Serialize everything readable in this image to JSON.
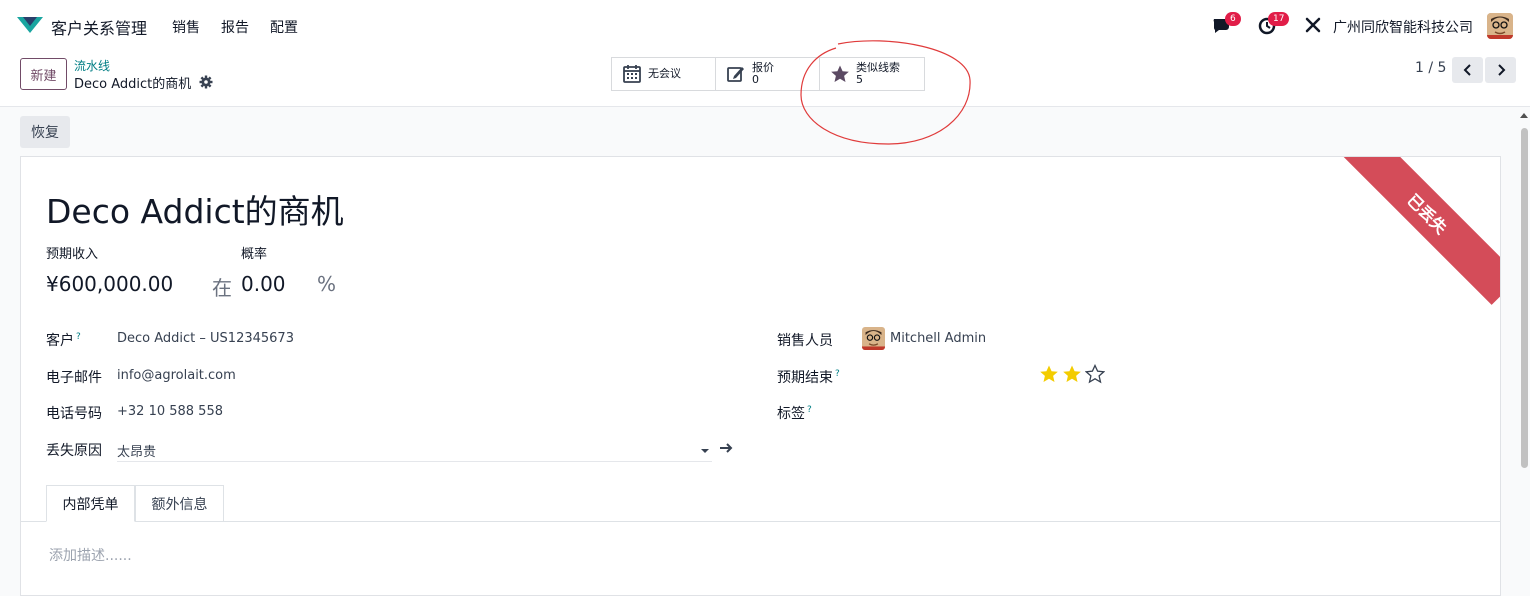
{
  "navbar": {
    "app_name": "客户关系管理",
    "menu": [
      "销售",
      "报告",
      "配置"
    ],
    "messages_badge": "6",
    "activity_badge": "17",
    "company": "广州同欣智能科技公司"
  },
  "control": {
    "new_label": "新建",
    "breadcrumb_parent": "流水线",
    "breadcrumb_current": "Deco Addict的商机",
    "smart_buttons": [
      {
        "icon": "calendar-icon",
        "label": "无会议",
        "value": ""
      },
      {
        "icon": "edit-icon",
        "label": "报价",
        "value": "0"
      },
      {
        "icon": "star-icon",
        "label": "类似线索",
        "value": "5"
      }
    ],
    "pager": "1 / 5"
  },
  "status": {
    "restore_label": "恢复"
  },
  "ribbon": {
    "label": "已丢失",
    "color": "#d44c59"
  },
  "form": {
    "title": "Deco Addict的商机",
    "expected_revenue_label": "预期收入",
    "expected_revenue": "¥600,000.00",
    "in_label": "在",
    "probability_label": "概率",
    "probability": "0.00",
    "percent": "%",
    "customer_label": "客户",
    "customer": "Deco Addict – US12345673",
    "email_label": "电子邮件",
    "email": "info@agrolait.com",
    "phone_label": "电话号码",
    "phone": "+32 10 588 558",
    "lost_reason_label": "丢失原因",
    "lost_reason": "太昂贵",
    "salesperson_label": "销售人员",
    "salesperson": "Mitchell Admin",
    "expected_close_label": "预期结束",
    "tags_label": "标签",
    "priority_stars": 2,
    "priority_max": 3,
    "help_mark": "?"
  },
  "tabs": [
    "内部凭单",
    "额外信息"
  ],
  "description_placeholder": "添加描述......"
}
